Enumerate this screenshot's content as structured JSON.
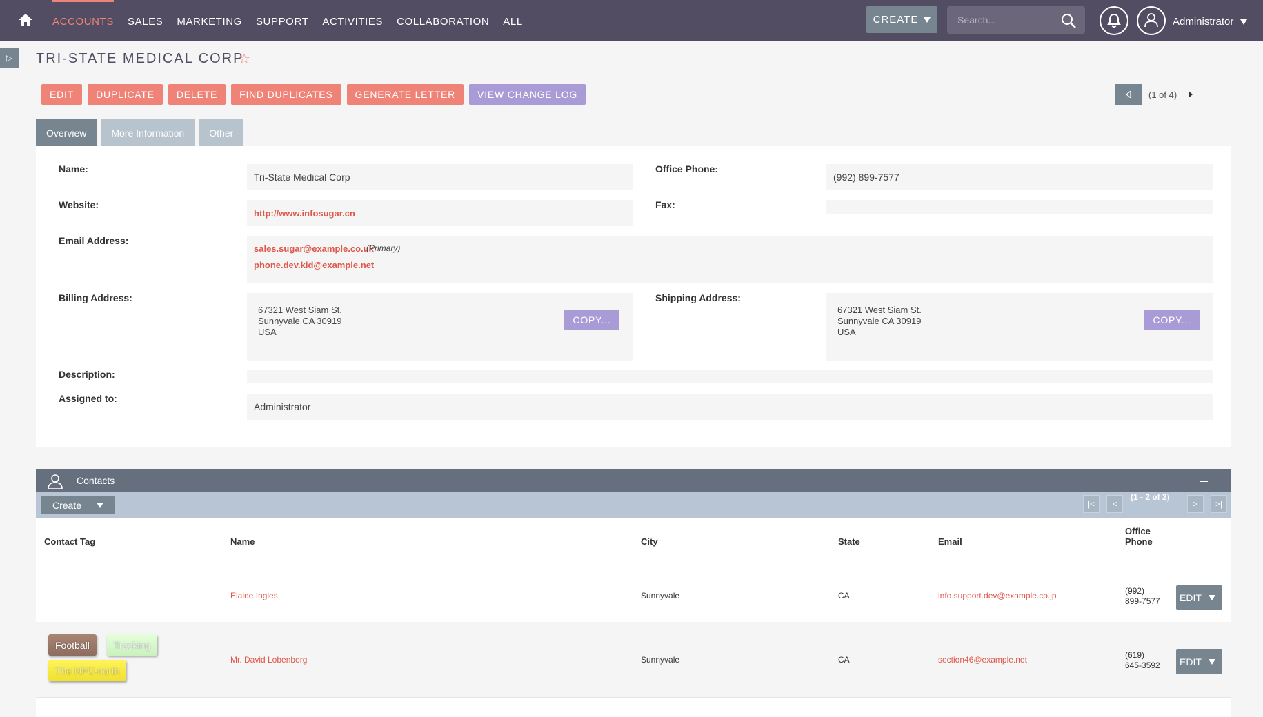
{
  "nav": {
    "items": [
      "ACCOUNTS",
      "SALES",
      "MARKETING",
      "SUPPORT",
      "ACTIVITIES",
      "COLLABORATION",
      "ALL"
    ],
    "create_label": "CREATE",
    "search_placeholder": "Search...",
    "user_name": "Administrator",
    "active_color": "#f08377"
  },
  "record": {
    "title": "TRI-STATE MEDICAL CORP",
    "actions": [
      "EDIT",
      "DUPLICATE",
      "DELETE",
      "FIND DUPLICATES",
      "GENERATE LETTER",
      "VIEW CHANGE LOG"
    ],
    "pager": "(1 of 4)"
  },
  "tabs": [
    "Overview",
    "More Information",
    "Other"
  ],
  "overview": {
    "name_label": "Name:",
    "name": "Tri-State Medical Corp",
    "phone_label": "Office Phone:",
    "phone": "(992) 899-7577",
    "website_label": "Website:",
    "website": "http://www.infosugar.cn",
    "fax_label": "Fax:",
    "fax": "",
    "email_label": "Email Address:",
    "email_primary": "sales.sugar@example.co.uk",
    "email_primary_tag": "(Primary)",
    "email_secondary": "phone.dev.kid@example.net",
    "billing_label": "Billing Address:",
    "billing": [
      "67321 West Siam St.",
      "Sunnyvale CA  30919",
      "USA"
    ],
    "shipping_label": "Shipping Address:",
    "shipping": [
      "67321 West Siam St.",
      "Sunnyvale CA  30919",
      "USA"
    ],
    "copy_label": "COPY...",
    "description_label": "Description:",
    "description": "",
    "assigned_label": "Assigned to:",
    "assigned": "Administrator"
  },
  "contacts": {
    "title": "Contacts",
    "create_label": "Create",
    "pager": "(1 - 2 of 2)",
    "pager_buttons": [
      "|<",
      "<",
      ">",
      ">|"
    ],
    "columns": [
      "Contact Tag",
      "Name",
      "City",
      "State",
      "Email",
      "Office",
      "Phone"
    ],
    "rows": [
      {
        "tags": [],
        "name": "Elaine Ingles",
        "city": "Sunnyvale",
        "state": "CA",
        "email": "info.support.dev@example.co.jp",
        "phone1": "(992)",
        "phone2": "899-7577"
      },
      {
        "tags": [
          "Football",
          "Tracking",
          "The NFC-north"
        ],
        "name": "Mr. David Lobenberg",
        "city": "Sunnyvale",
        "state": "CA",
        "email": "section46@example.net",
        "phone1": "(619)",
        "phone2": "645-3592"
      }
    ],
    "edit_label": "EDIT"
  }
}
